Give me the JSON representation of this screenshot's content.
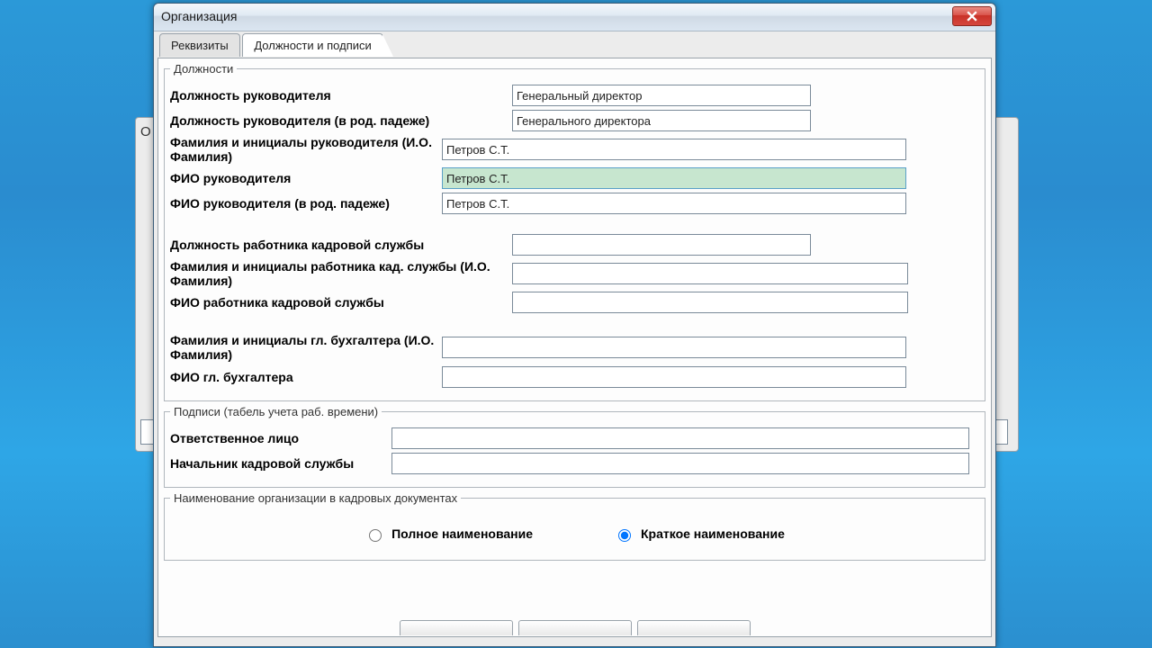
{
  "window": {
    "title": "Организация"
  },
  "tabs": {
    "details": "Реквизиты",
    "positions": "Должности и подписи"
  },
  "groups": {
    "positions_title": "Должности",
    "signatures_title": "Подписи (табель учета раб. времени)",
    "orgname_title": "Наименование организации в кадровых документах"
  },
  "labels": {
    "head_position": "Должность руководителя",
    "head_position_gen": "Должность руководителя (в род. падеже)",
    "head_short": "Фамилия и инициалы руководителя (И.О. Фамилия)",
    "head_fio": "ФИО руководителя",
    "head_fio_gen": "ФИО руководителя (в род. падеже)",
    "hr_position": "Должность работника кадровой службы",
    "hr_short": "Фамилия и инициалы работника кад. службы (И.О. Фамилия)",
    "hr_fio": "ФИО работника кадровой службы",
    "acc_short": "Фамилия и инициалы гл. бухгалтера (И.О. Фамилия)",
    "acc_fio": "ФИО гл. бухгалтера",
    "responsible": "Ответственное лицо",
    "hr_chief": "Начальник кадровой службы",
    "full_name": "Полное наименование",
    "short_name": "Краткое наименование"
  },
  "values": {
    "head_position": "Генеральный директор",
    "head_position_gen": "Генерального директора",
    "head_short": "Петров С.Т.",
    "head_fio": "Петров С.Т.",
    "head_fio_gen": "Петров С.Т.",
    "hr_position": "",
    "hr_short": "",
    "hr_fio": "",
    "acc_short": "",
    "acc_fio": "",
    "responsible": "",
    "hr_chief": ""
  },
  "orgname_option": "short"
}
